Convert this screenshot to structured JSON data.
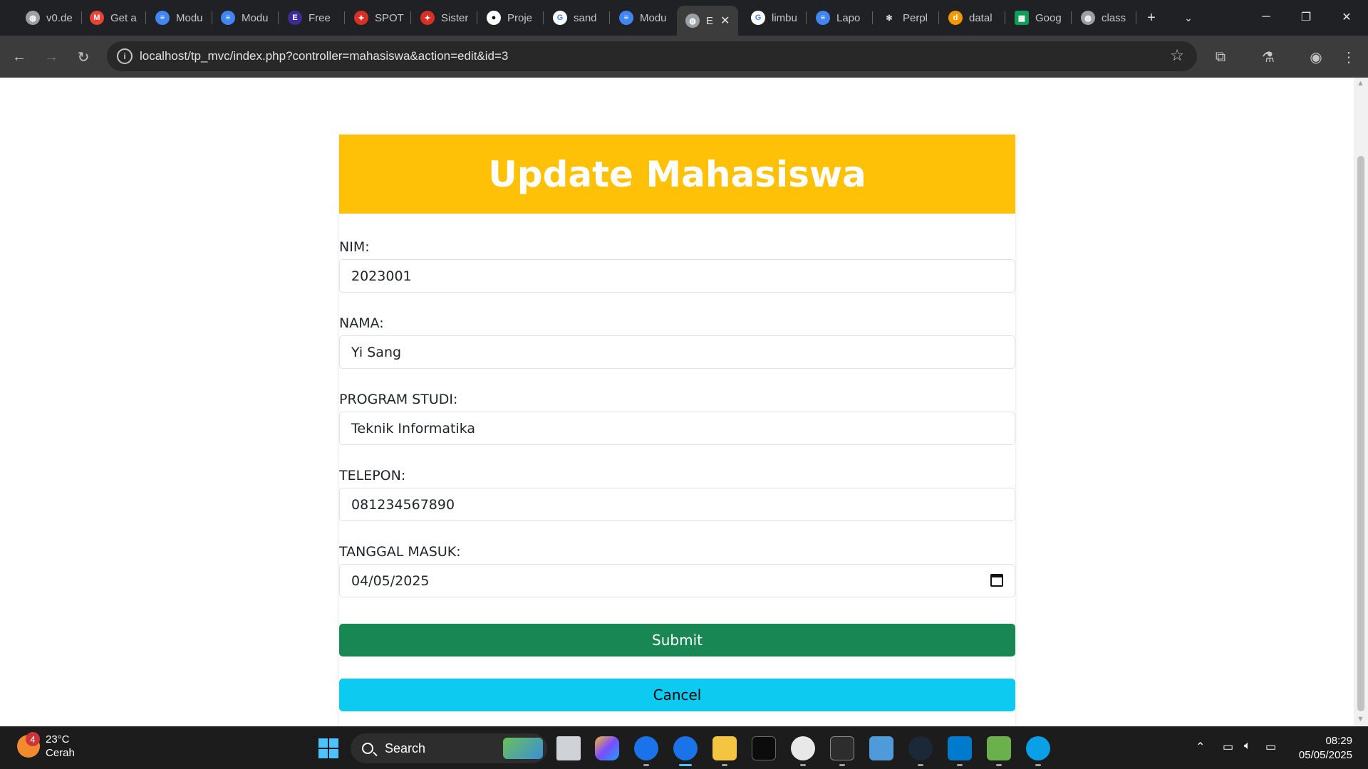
{
  "browser": {
    "tabs": [
      {
        "title": "v0.de",
        "icon": "globe-icon",
        "color": "#9aa0a6"
      },
      {
        "title": "Get a",
        "icon": "gmail-icon",
        "color": "#ea4335"
      },
      {
        "title": "Modu",
        "icon": "doc-icon",
        "color": "#4285f4"
      },
      {
        "title": "Modu",
        "icon": "doc-icon",
        "color": "#4285f4"
      },
      {
        "title": "Free",
        "icon": "elementor-icon",
        "color": "#3f2a99"
      },
      {
        "title": "SPOT",
        "icon": "spot-icon",
        "color": "#d93025"
      },
      {
        "title": "Sister",
        "icon": "spot-icon",
        "color": "#d93025"
      },
      {
        "title": "Proje",
        "icon": "github-icon",
        "color": "#ffffff"
      },
      {
        "title": "sand",
        "icon": "google-icon",
        "color": "#4285f4"
      },
      {
        "title": "Modu",
        "icon": "doc-icon",
        "color": "#4285f4"
      },
      {
        "title": "E",
        "icon": "globe-icon",
        "color": "#9aa0a6",
        "active": true
      },
      {
        "title": "limbu",
        "icon": "google-icon",
        "color": "#4285f4"
      },
      {
        "title": "Lapo",
        "icon": "doc-icon",
        "color": "#4285f4"
      },
      {
        "title": "Perpl",
        "icon": "perplexity-icon",
        "color": "#e3e3e3"
      },
      {
        "title": "datal",
        "icon": "datalab-icon",
        "color": "#f29900"
      },
      {
        "title": "Goog",
        "icon": "sheets-icon",
        "color": "#0f9d58"
      },
      {
        "title": "class",
        "icon": "globe-icon",
        "color": "#9aa0a6"
      }
    ],
    "url": "localhost/tp_mvc/index.php?controller=mahasiswa&action=edit&id=3"
  },
  "form": {
    "title": "Update Mahasiswa",
    "fields": [
      {
        "label": "NIM:",
        "value": "2023001"
      },
      {
        "label": "NAMA:",
        "value": "Yi Sang"
      },
      {
        "label": "PROGRAM STUDI:",
        "value": "Teknik Informatika"
      },
      {
        "label": "TELEPON:",
        "value": "081234567890"
      },
      {
        "label": "TANGGAL MASUK:",
        "value": "04/05/2025"
      }
    ],
    "submit_label": "Submit",
    "cancel_label": "Cancel",
    "colors": {
      "header": "#ffc107",
      "submit": "#198754",
      "cancel": "#0dcaf0"
    }
  },
  "taskbar": {
    "weather": {
      "temp": "23°C",
      "condition": "Cerah",
      "badge": "4"
    },
    "search_label": "Search",
    "time": "08:29",
    "date": "05/05/2025"
  }
}
